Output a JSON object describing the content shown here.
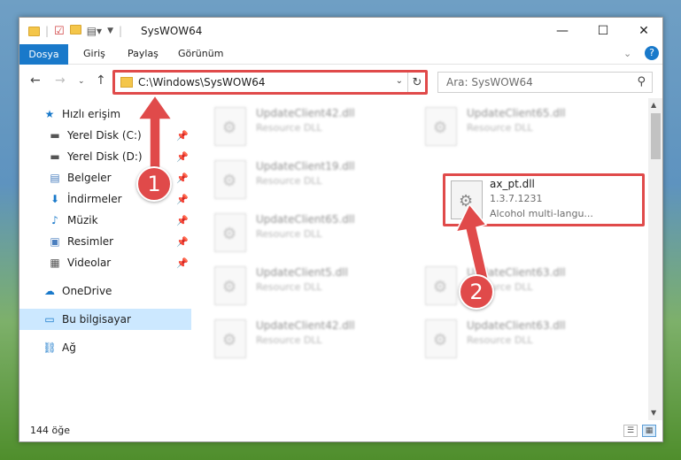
{
  "window": {
    "title": "SysWOW64",
    "controls": {
      "minimize": "—",
      "maximize": "☐",
      "close": "✕"
    }
  },
  "ribbon": {
    "file_tab": "Dosya",
    "tabs": [
      "Giriş",
      "Paylaş",
      "Görünüm"
    ],
    "help": "?"
  },
  "address": {
    "path": "C:\\Windows\\SysWOW64",
    "search_placeholder": "Ara: SysWOW64"
  },
  "sidebar": {
    "items": [
      {
        "label": "Hızlı erişim",
        "icon": "star-icon",
        "pinned": false
      },
      {
        "label": "Yerel Disk (C:)",
        "icon": "drive-icon",
        "pinned": true
      },
      {
        "label": "Yerel Disk (D:)",
        "icon": "drive-icon",
        "pinned": true
      },
      {
        "label": "Belgeler",
        "icon": "documents-icon",
        "pinned": true
      },
      {
        "label": "İndirmeler",
        "icon": "download-icon",
        "pinned": true
      },
      {
        "label": "Müzik",
        "icon": "music-icon",
        "pinned": true
      },
      {
        "label": "Resimler",
        "icon": "pictures-icon",
        "pinned": true
      },
      {
        "label": "Videolar",
        "icon": "video-icon",
        "pinned": true
      },
      {
        "label": "OneDrive",
        "icon": "cloud-icon",
        "pinned": false
      },
      {
        "label": "Bu bilgisayar",
        "icon": "computer-icon",
        "pinned": false,
        "selected": true
      },
      {
        "label": "Ağ",
        "icon": "network-icon",
        "pinned": false
      }
    ]
  },
  "files": [
    {
      "name": "UpdateClient42.dll",
      "type": "Resource DLL"
    },
    {
      "name": "UpdateClient65.dll",
      "type": "Resource DLL"
    },
    {
      "name": "UpdateClient19.dll",
      "type": "Resource DLL"
    },
    {
      "name": "UpdateClient65.dll",
      "type": "Resource DLL"
    },
    {
      "name": "UpdateClient5.dll",
      "type": "Resource DLL"
    },
    {
      "name": "UpdateClient63.dll",
      "type": "Resource DLL"
    },
    {
      "name": "UpdateClient42.dll",
      "type": "Resource DLL"
    },
    {
      "name": "UpdateClient63.dll",
      "type": "Resource DLL"
    }
  ],
  "target_file": {
    "name": "ax_pt.dll",
    "version": "1.3.7.1231",
    "description": "Alcohol multi-langu..."
  },
  "status": {
    "count": "144 öğe"
  },
  "annotations": {
    "step1": "1",
    "step2": "2",
    "color": "#e04a4a"
  }
}
